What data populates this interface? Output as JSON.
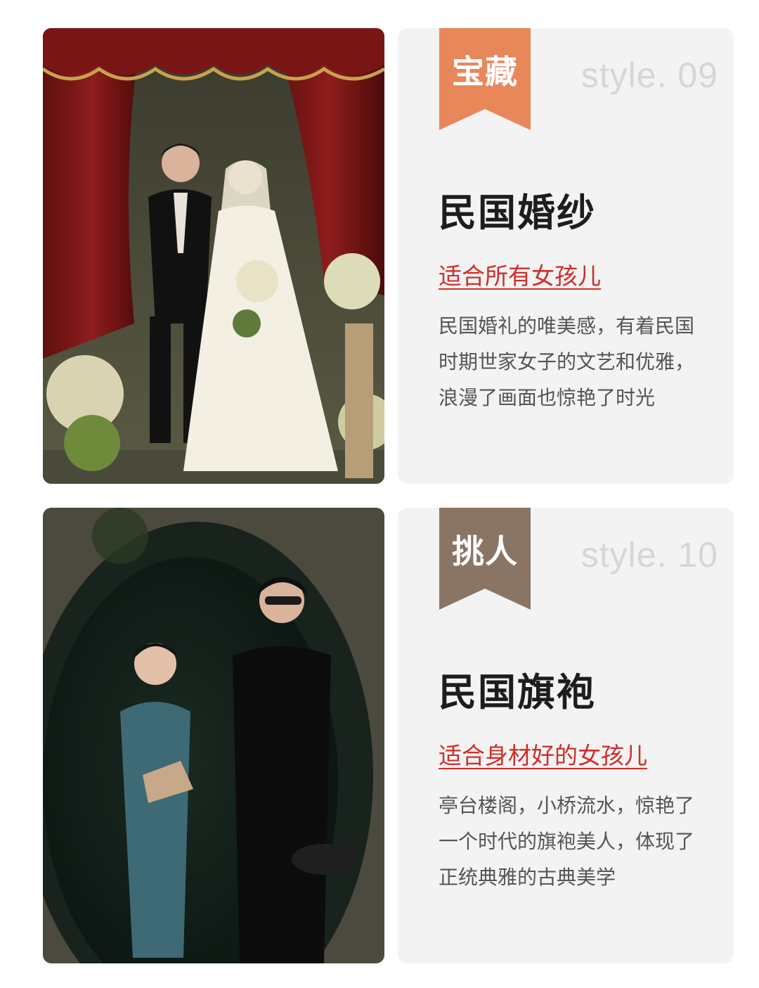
{
  "items": [
    {
      "tag": "宝藏",
      "tag_color": "#e8875a",
      "style_label": "style. 09",
      "title": "民国婚纱",
      "subtitle": "适合所有女孩儿",
      "desc_lines": [
        "民国婚礼的唯美感，有着民国",
        "时期世家女子的文艺和优雅，",
        "浪漫了画面也惊艳了时光"
      ],
      "photo_icon": "wedding-photo"
    },
    {
      "tag": "挑人",
      "tag_color": "#8a7565",
      "style_label": "style. 10",
      "title": "民国旗袍",
      "subtitle": "适合身材好的女孩儿",
      "desc_lines": [
        "亭台楼阁，小桥流水，惊艳了",
        "一个时代的旗袍美人，体现了",
        "正统典雅的古典美学"
      ],
      "photo_icon": "qipao-photo"
    }
  ]
}
